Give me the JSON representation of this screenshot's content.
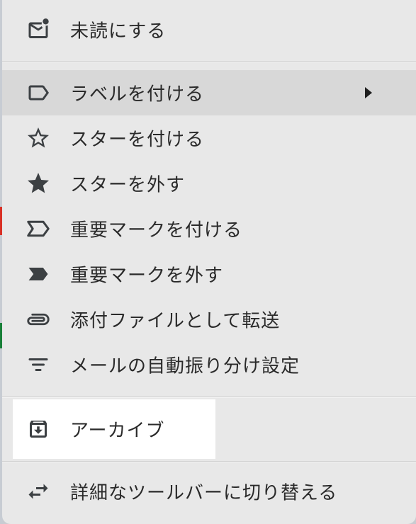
{
  "menu": {
    "items": [
      {
        "label": "未読にする",
        "icon": "mark-unread-icon"
      },
      {
        "label": "ラベルを付ける",
        "icon": "label-icon",
        "submenu": true
      },
      {
        "label": "スターを付ける",
        "icon": "star-outline-icon"
      },
      {
        "label": "スターを外す",
        "icon": "star-filled-icon"
      },
      {
        "label": "重要マークを付ける",
        "icon": "important-outline-icon"
      },
      {
        "label": "重要マークを外す",
        "icon": "important-filled-icon"
      },
      {
        "label": "添付ファイルとして転送",
        "icon": "attachment-icon"
      },
      {
        "label": "メールの自動振り分け設定",
        "icon": "filter-icon"
      },
      {
        "label": "アーカイブ",
        "icon": "archive-icon"
      },
      {
        "label": "詳細なツールバーに切り替える",
        "icon": "swap-icon"
      }
    ]
  },
  "colors": {
    "menu_background": "#e8e8e8",
    "hover_background": "#d8d8d8",
    "selected_background": "#ffffff",
    "text": "#2a2a2a",
    "icon": "#3c4043"
  }
}
